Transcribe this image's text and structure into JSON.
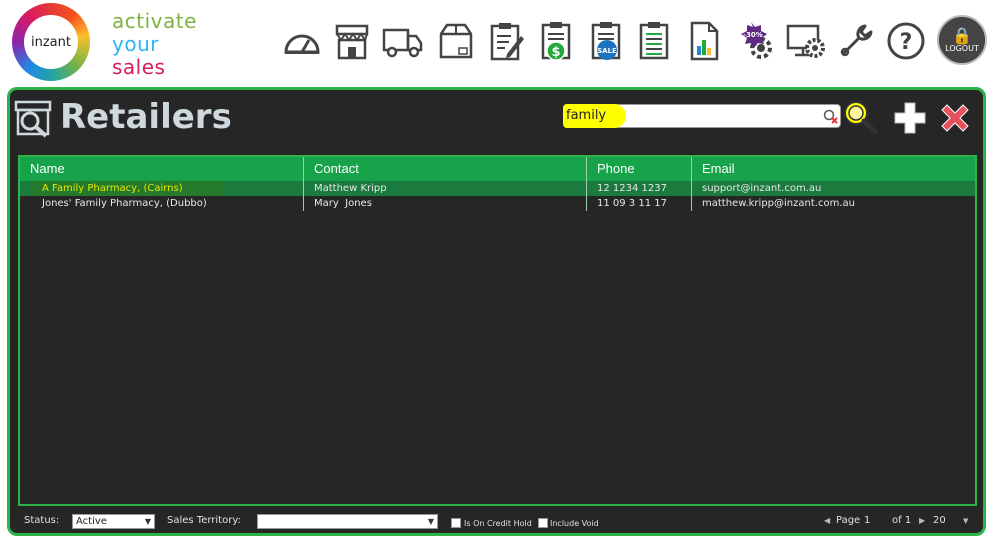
{
  "brand": {
    "logo_text": "inzant",
    "tagline": [
      "activate",
      "your",
      "sales"
    ]
  },
  "nav": {
    "icons": [
      "dashboard-icon",
      "store-icon",
      "truck-icon",
      "box-icon",
      "clipboard-edit-icon",
      "clipboard-dollar-icon",
      "clipboard-sale-icon",
      "clipboard-list-icon",
      "report-chart-icon",
      "discount-settings-icon",
      "monitor-settings-icon",
      "wrench-icon",
      "help-icon"
    ],
    "sale_badge": "SALE",
    "discount_badge": "-30%",
    "help_glyph": "?",
    "logout_label": "LOGOUT"
  },
  "page": {
    "title": "Retailers"
  },
  "search": {
    "value": "family"
  },
  "table": {
    "columns": [
      "Name",
      "Contact",
      "Phone",
      "Email"
    ],
    "rows": [
      {
        "name": "A Family Pharmacy, (Cairns)",
        "contact": "Matthew Kripp",
        "phone": "12 1234 1237",
        "email": "support@inzant.com.au"
      },
      {
        "name": "Jones' Family Pharmacy, (Dubbo)",
        "contact": "Mary  Jones",
        "phone": "11 09 3 11 17",
        "email": "matthew.kripp@inzant.com.au"
      }
    ]
  },
  "footer": {
    "status_label": "Status:",
    "status_value": "Active",
    "territory_label": "Sales Territory:",
    "territory_value": "",
    "credit_hold_label": "Is On Credit Hold",
    "include_void_label": "Include Void",
    "page_label": "Page",
    "page_number": "1",
    "page_of": "of 1",
    "page_size": "20"
  },
  "colors": {
    "accent_green": "#2db34a",
    "header_green": "#16a34a",
    "panel_bg": "#262626",
    "highlight_yellow": "#ffff00",
    "selected_row": "#1b7a3d"
  }
}
